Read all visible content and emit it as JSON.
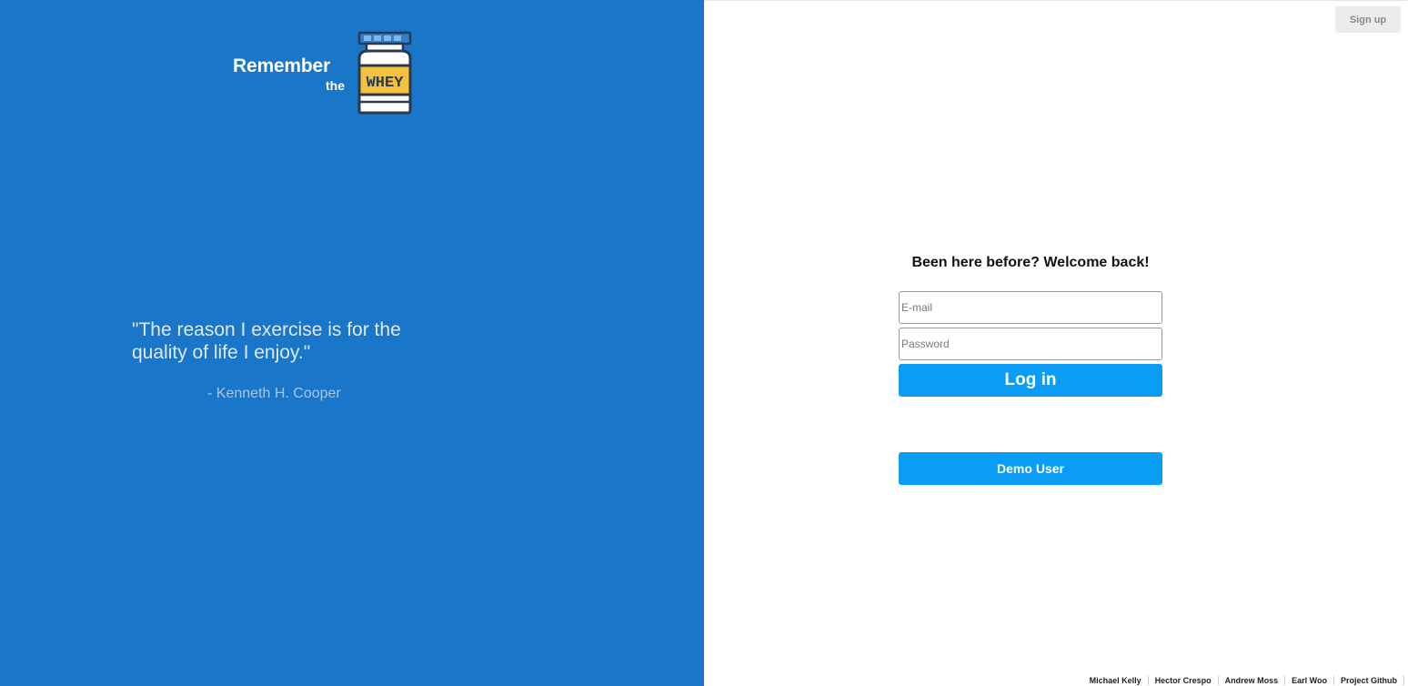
{
  "brand": {
    "logo_remember": "Remember",
    "logo_the": "the",
    "logo_jar_label": "WHEY",
    "logo_icon": "protein-jar-icon",
    "colors": {
      "left_panel_bg": "#1976c8",
      "jar_label_yellow": "#f6c23e",
      "jar_lid_blue": "#2f7fd0",
      "jar_outline": "#2b3a4a"
    }
  },
  "quote": {
    "text": "\"The reason I exercise is for the quality of life I enjoy.\"",
    "author": "- Kenneth H. Cooper"
  },
  "header": {
    "signup_label": "Sign up"
  },
  "login": {
    "heading": "Been here before? Welcome back!",
    "email_placeholder": "E-mail",
    "email_value": "",
    "password_placeholder": "Password",
    "password_value": "",
    "login_label": "Log in",
    "demo_label": "Demo User",
    "button_color": "#0b9cf5"
  },
  "footer": {
    "links": [
      "Michael Kelly",
      "Hector Crespo",
      "Andrew Moss",
      "Earl Woo",
      "Project Github"
    ]
  }
}
